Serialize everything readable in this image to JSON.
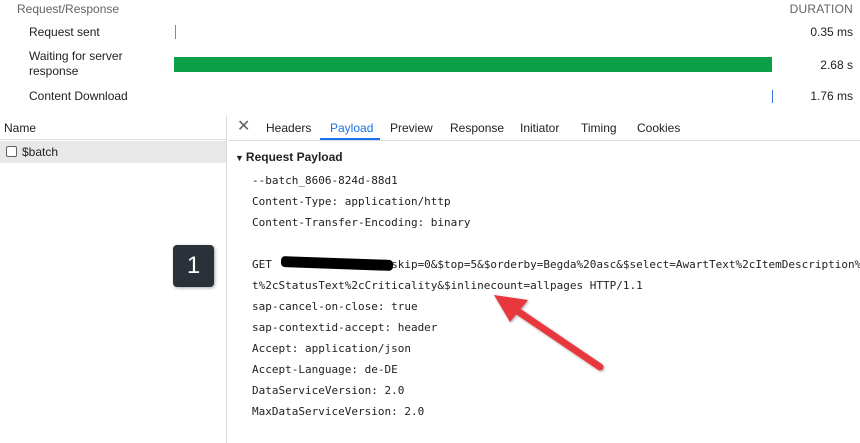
{
  "timing": {
    "section_label": "Request/Response",
    "duration_label": "DURATION",
    "rows": [
      {
        "label": "Request sent",
        "value": "0.35 ms"
      },
      {
        "label": "Waiting for server response",
        "value": "2.68 s"
      },
      {
        "label": "Content Download",
        "value": "1.76 ms"
      }
    ],
    "bar_color": "#0ba047"
  },
  "left_pane": {
    "header": "Name",
    "request": "$batch"
  },
  "tabs": [
    "Headers",
    "Payload",
    "Preview",
    "Response",
    "Initiator",
    "Timing",
    "Cookies"
  ],
  "active_tab": "Payload",
  "payload": {
    "title": "Request Payload",
    "lines": [
      "--batch_8606-824d-88d1",
      "Content-Type: application/http",
      "Content-Transfer-Encoding: binary",
      "",
      "GET                 $skip=0&$top=5&$orderby=Begda%20asc&$select=AwartText%2cItemDescription%",
      "t%2cStatusText%2cCriticality&$inlinecount=allpages HTTP/1.1",
      "sap-cancel-on-close: true",
      "sap-contextid-accept: header",
      "Accept: application/json",
      "Accept-Language: de-DE",
      "DataServiceVersion: 2.0",
      "MaxDataServiceVersion: 2.0"
    ]
  },
  "annotation": {
    "badge": "1",
    "arrow_color": "#e8383d"
  },
  "icons": {
    "close": "close-icon",
    "expand": "triangle-down-icon",
    "checkbox": "checkbox-icon"
  }
}
